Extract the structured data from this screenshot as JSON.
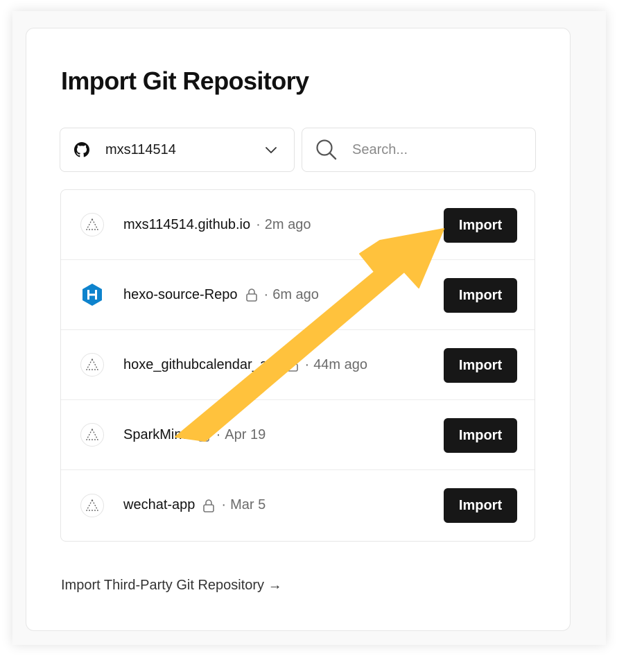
{
  "page": {
    "title": "Import Git Repository"
  },
  "account_selector": {
    "value": "mxs114514",
    "icon": "github-icon"
  },
  "search": {
    "placeholder": "Search..."
  },
  "repositories": [
    {
      "name": "mxs114514.github.io",
      "private": false,
      "separator": "·",
      "time": "2m ago",
      "avatar": "vercel-triangle-icon",
      "action": "Import"
    },
    {
      "name": "hexo-source-Repo",
      "private": true,
      "separator": "·",
      "time": "6m ago",
      "avatar": "hexo-icon",
      "action": "Import"
    },
    {
      "name": "hoxe_githubcalendar_api",
      "private": true,
      "separator": "·",
      "time": "44m ago",
      "avatar": "vercel-triangle-icon",
      "action": "Import"
    },
    {
      "name": "SparkMind",
      "private": true,
      "separator": "·",
      "time": "Apr 19",
      "avatar": "vercel-triangle-icon",
      "action": "Import"
    },
    {
      "name": "wechat-app",
      "private": true,
      "separator": "·",
      "time": "Mar 5",
      "avatar": "vercel-triangle-icon",
      "action": "Import"
    }
  ],
  "footer": {
    "third_party_link": "Import Third-Party Git Repository →"
  },
  "colors": {
    "button_bg": "#171717",
    "arrow": "#FFC23D",
    "hexo_blue": "#0E83CD"
  }
}
